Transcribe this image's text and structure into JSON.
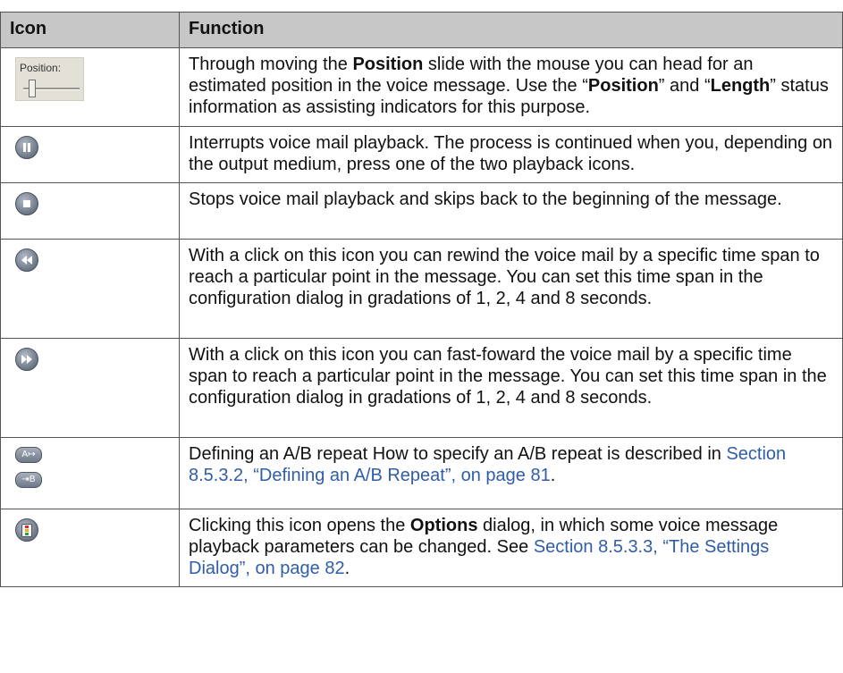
{
  "table": {
    "header": {
      "icon": "Icon",
      "function": "Function"
    },
    "rows": [
      {
        "icon": "position-slider-icon",
        "slider_label": "Position:",
        "parts": [
          {
            "t": "Through moving the "
          },
          {
            "t": "Position",
            "b": true
          },
          {
            "t": " slide with the mouse you can head for an estimated position in the voice message. Use the “"
          },
          {
            "t": "Position",
            "b": true
          },
          {
            "t": "” and “"
          },
          {
            "t": "Length",
            "b": true
          },
          {
            "t": "” status information as assisting indicators for this purpose."
          }
        ]
      },
      {
        "icon": "pause-icon",
        "parts": [
          {
            "t": "Interrupts voice mail playback. The process is continued when you, depending on the output medium, press one of the two playback icons."
          }
        ]
      },
      {
        "icon": "stop-icon",
        "parts": [
          {
            "t": "Stops voice mail playback and skips back to the beginning of the message."
          }
        ]
      },
      {
        "icon": "rewind-icon",
        "parts": [
          {
            "t": "With a click on this icon you can rewind the voice mail by a specific time span to reach a particular point in the message. You can set this time span in the configuration dialog in gradations of 1, 2, 4 and 8 seconds."
          }
        ]
      },
      {
        "icon": "fast-forward-icon",
        "parts": [
          {
            "t": "With a click on this icon you can fast-foward the voice mail by a specific time span to reach a particular point in the message. You can set this time span in the configuration dialog in gradations of 1, 2, 4 and 8 seconds."
          }
        ]
      },
      {
        "icon": "ab-repeat-icons",
        "ab_a_label": "A↦",
        "ab_b_label": "⇥B",
        "parts": [
          {
            "t": "Defining an A/B repeat How to specify an A/B repeat is described in "
          },
          {
            "t": "Section 8.5.3.2, “Defining an A/B Repeat”, on page 81",
            "link": true
          },
          {
            "t": "."
          }
        ]
      },
      {
        "icon": "settings-icon",
        "parts": [
          {
            "t": "Clicking this icon opens the "
          },
          {
            "t": "Options",
            "b": true
          },
          {
            "t": " dialog, in which some voice message playback parameters can be changed. See "
          },
          {
            "t": "Section 8.5.3.3, “The Settings Dialog”, on page 82",
            "link": true
          },
          {
            "t": "."
          }
        ]
      }
    ]
  },
  "colors": {
    "header_bg": "#c7c7c7",
    "link": "#2f5da8",
    "border": "#555555"
  }
}
